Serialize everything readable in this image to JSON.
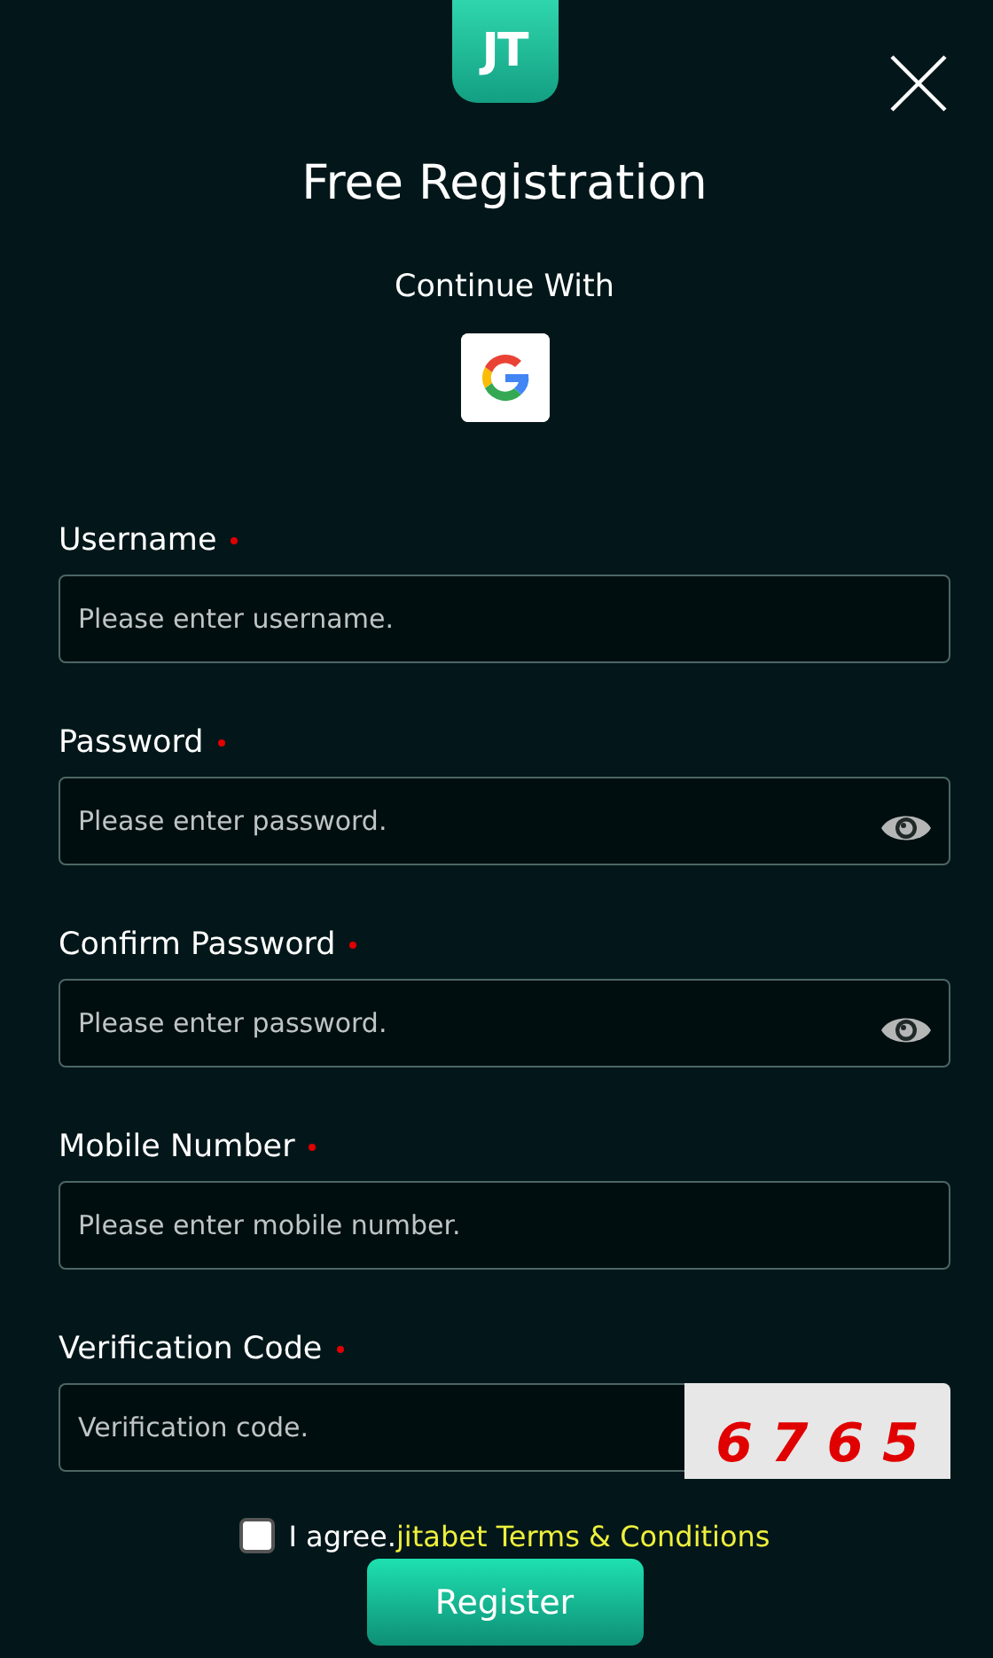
{
  "logo": {
    "text": "JT"
  },
  "title": "Free Registration",
  "social": {
    "label": "Continue With"
  },
  "fields": [
    {
      "kind": "text",
      "label": "Username",
      "required": true,
      "placeholder": "Please enter username."
    },
    {
      "kind": "password",
      "label": "Password",
      "required": true,
      "placeholder": "Please enter password."
    },
    {
      "kind": "password",
      "label": "Confirm Password",
      "required": true,
      "placeholder": "Please enter password."
    },
    {
      "kind": "text",
      "label": "Mobile Number",
      "required": true,
      "placeholder": "Please enter mobile number."
    },
    {
      "kind": "captcha",
      "label": "Verification Code",
      "required": true,
      "placeholder": "Verification code.",
      "captcha": "6 7 6 5"
    }
  ],
  "agree": {
    "checked": false,
    "text": "I agree.",
    "link": "jitabet Terms & Conditions"
  },
  "submit": "Register"
}
